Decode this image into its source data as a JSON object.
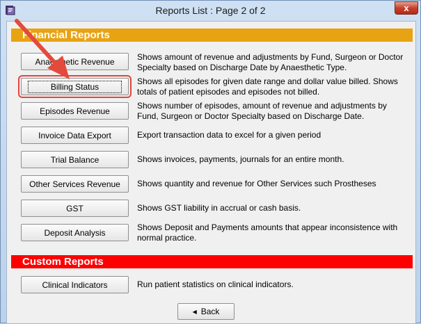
{
  "window": {
    "title": "Reports List : Page 2 of 2",
    "close_label": "x",
    "app_icon": "report-book-icon"
  },
  "sections": {
    "financial_title": "Financial Reports",
    "custom_title": "Custom Reports"
  },
  "financial_reports": [
    {
      "label": "Anaesthetic Revenue",
      "desc": "Shows amount of revenue and adjustments by Fund, Surgeon or Doctor Specialty based on Discharge Date by Anaesthetic Type."
    },
    {
      "label": "Billing Status",
      "desc": "Shows all episodes for given date range and dollar value billed. Shows totals of patient episodes and episodes not billed."
    },
    {
      "label": "Episodes Revenue",
      "desc": "Shows number of episodes, amount of revenue and adjustments by Fund, Surgeon or Doctor Specialty based on Discharge Date."
    },
    {
      "label": "Invoice Data Export",
      "desc": "Export transaction data to excel for a given period"
    },
    {
      "label": "Trial Balance",
      "desc": "Shows invoices, payments, journals for an entire month."
    },
    {
      "label": "Other Services Revenue",
      "desc": "Shows quantity and revenue for Other Services such Prostheses"
    },
    {
      "label": "GST",
      "desc": "Shows GST liability in accrual or cash basis."
    },
    {
      "label": "Deposit Analysis",
      "desc": "Shows Deposit and Payments amounts that appear inconsistence with normal practice."
    }
  ],
  "custom_reports": [
    {
      "label": "Clinical Indicators",
      "desc": "Run patient statistics on clinical indicators."
    }
  ],
  "navigation": {
    "back_label": "Back",
    "back_icon": "left-triangle-icon"
  },
  "highlight": {
    "color": "#e0463c",
    "selected_report": "Billing Status"
  },
  "colors": {
    "financial_header": "#e8a312",
    "custom_header": "#ff0000"
  }
}
